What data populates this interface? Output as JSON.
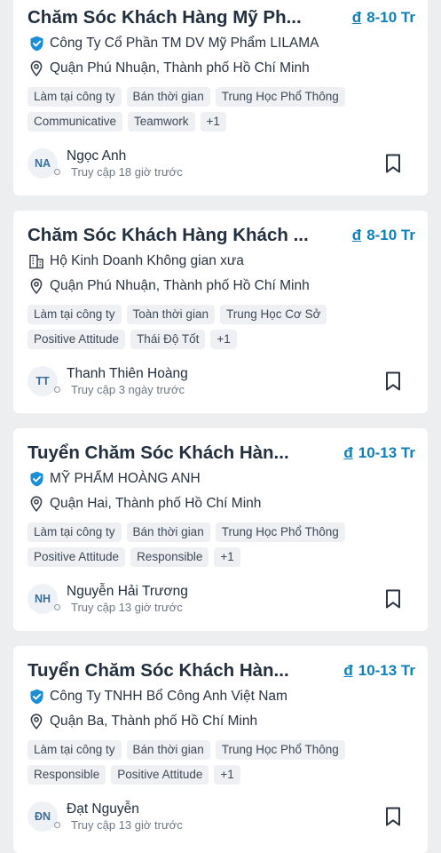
{
  "jobs": [
    {
      "title": "Chăm Sóc Khách Hàng Mỹ Ph...",
      "salary_currency": "đ",
      "salary": "8-10 Tr",
      "company_icon": "verified-check-icon",
      "company": "Công Ty Cổ Phần TM DV Mỹ Phẩm LILAMA",
      "location": "Quận Phú Nhuận, Thành phố Hồ Chí Minh",
      "tags_row1": [
        "Làm tại công ty",
        "Bán thời gian",
        "Trung Học Phổ Thông"
      ],
      "tags_row2": [
        "Communicative",
        "Teamwork",
        "+1"
      ],
      "recruiter_initials": "NA",
      "recruiter_name": "Ngọc Anh",
      "recruiter_active": "Truy cập 18 giờ trước"
    },
    {
      "title": "Chăm Sóc Khách Hàng Khách ...",
      "salary_currency": "đ",
      "salary": "8-10 Tr",
      "company_icon": "building-icon",
      "company": "Hộ Kinh Doanh Không gian xưa",
      "location": "Quận Phú Nhuận, Thành phố Hồ Chí Minh",
      "tags_row1": [
        "Làm tại công ty",
        "Toàn thời gian",
        "Trung Học Cơ Sở"
      ],
      "tags_row2": [
        "Positive Attitude",
        "Thái Độ Tốt",
        "+1"
      ],
      "recruiter_initials": "TT",
      "recruiter_name": "Thanh Thiên  Hoàng",
      "recruiter_active": "Truy cập 3 ngày trước"
    },
    {
      "title": "Tuyển Chăm Sóc Khách Hàn...",
      "salary_currency": "đ",
      "salary": "10-13 Tr",
      "company_icon": "verified-check-icon",
      "company": "MỸ PHẨM HOÀNG ANH",
      "location": "Quận Hai, Thành phố Hồ Chí Minh",
      "tags_row1": [
        "Làm tại công ty",
        "Bán thời gian",
        "Trung Học Phổ Thông"
      ],
      "tags_row2": [
        "Positive Attitude",
        "Responsible",
        "+1"
      ],
      "recruiter_initials": "NH",
      "recruiter_name": "Nguyễn Hải Trương",
      "recruiter_active": "Truy cập 13 giờ trước"
    },
    {
      "title": "Tuyển Chăm Sóc Khách Hàn...",
      "salary_currency": "đ",
      "salary": "10-13 Tr",
      "company_icon": "verified-check-icon",
      "company": "Công Ty TNHH Bổ Công Anh Việt Nam",
      "location": "Quận Ba, Thành phố Hồ Chí Minh",
      "tags_row1": [
        "Làm tại công ty",
        "Bán thời gian",
        "Trung Học Phổ Thông"
      ],
      "tags_row2": [
        "Responsible",
        "Positive Attitude",
        "+1"
      ],
      "recruiter_initials": "ĐN",
      "recruiter_name": "Đạt Nguyễn",
      "recruiter_active": "Truy cập 13 giờ trước"
    }
  ],
  "colors": {
    "salary": "#0e7fb8",
    "verified": "#1a8fd6",
    "tag_bg": "#eef0f3"
  }
}
